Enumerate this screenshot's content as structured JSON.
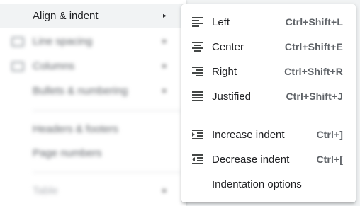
{
  "parent_menu": {
    "active_item": {
      "label": "Align & indent",
      "arrow": "▸"
    },
    "blurred_items": [
      {
        "label": "Line spacing",
        "icon": "line-spacing-icon",
        "arrow": "▸"
      },
      {
        "label": "Columns",
        "icon": "columns-icon",
        "arrow": "▸"
      },
      {
        "label": "Bullets & numbering",
        "arrow": "▸"
      },
      {
        "label": "Headers & footers"
      },
      {
        "label": "Page numbers"
      },
      {
        "label": "Table",
        "arrow": "▸"
      }
    ]
  },
  "submenu": {
    "items": [
      {
        "label": "Left",
        "shortcut": "Ctrl+Shift+L",
        "icon": "align-left-icon"
      },
      {
        "label": "Center",
        "shortcut": "Ctrl+Shift+E",
        "icon": "align-center-icon"
      },
      {
        "label": "Right",
        "shortcut": "Ctrl+Shift+R",
        "icon": "align-right-icon"
      },
      {
        "label": "Justified",
        "shortcut": "Ctrl+Shift+J",
        "icon": "align-justify-icon"
      },
      {
        "label": "Increase indent",
        "shortcut": "Ctrl+]",
        "icon": "increase-indent-icon"
      },
      {
        "label": "Decrease indent",
        "shortcut": "Ctrl+[",
        "icon": "decrease-indent-icon"
      },
      {
        "label": "Indentation options",
        "shortcut": ""
      }
    ]
  },
  "colors": {
    "text": "#202124",
    "shortcut": "#5f6368",
    "icon": "#444746",
    "active_row": "#f1f3f4"
  }
}
